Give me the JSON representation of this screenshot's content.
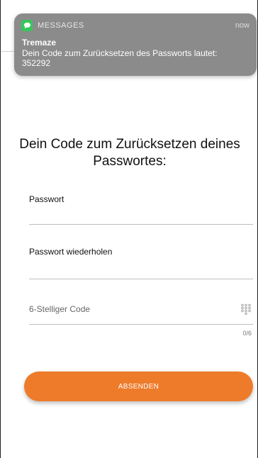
{
  "notification": {
    "app_name": "MESSAGES",
    "time": "now",
    "title": "Tremaze",
    "body": "Dein Code zum Zurücksetzen des Passworts lautet: 352292"
  },
  "form": {
    "heading": "Dein Code zum Zurücksetzen deines Passwortes:",
    "password_label": "Passwort",
    "password_value": "",
    "repeat_label": "Passwort wiederholen",
    "repeat_value": "",
    "code_placeholder": "6-Stelliger Code",
    "code_value": "",
    "code_counter": "0/6",
    "submit_label": "ABSENDEN"
  },
  "colors": {
    "accent": "#ee7b2a",
    "notification_bg": "#8b8b8b",
    "messages_icon": "#34c759"
  },
  "icons": {
    "notification": "message-bubble-icon",
    "code_field": "keypad-icon"
  }
}
